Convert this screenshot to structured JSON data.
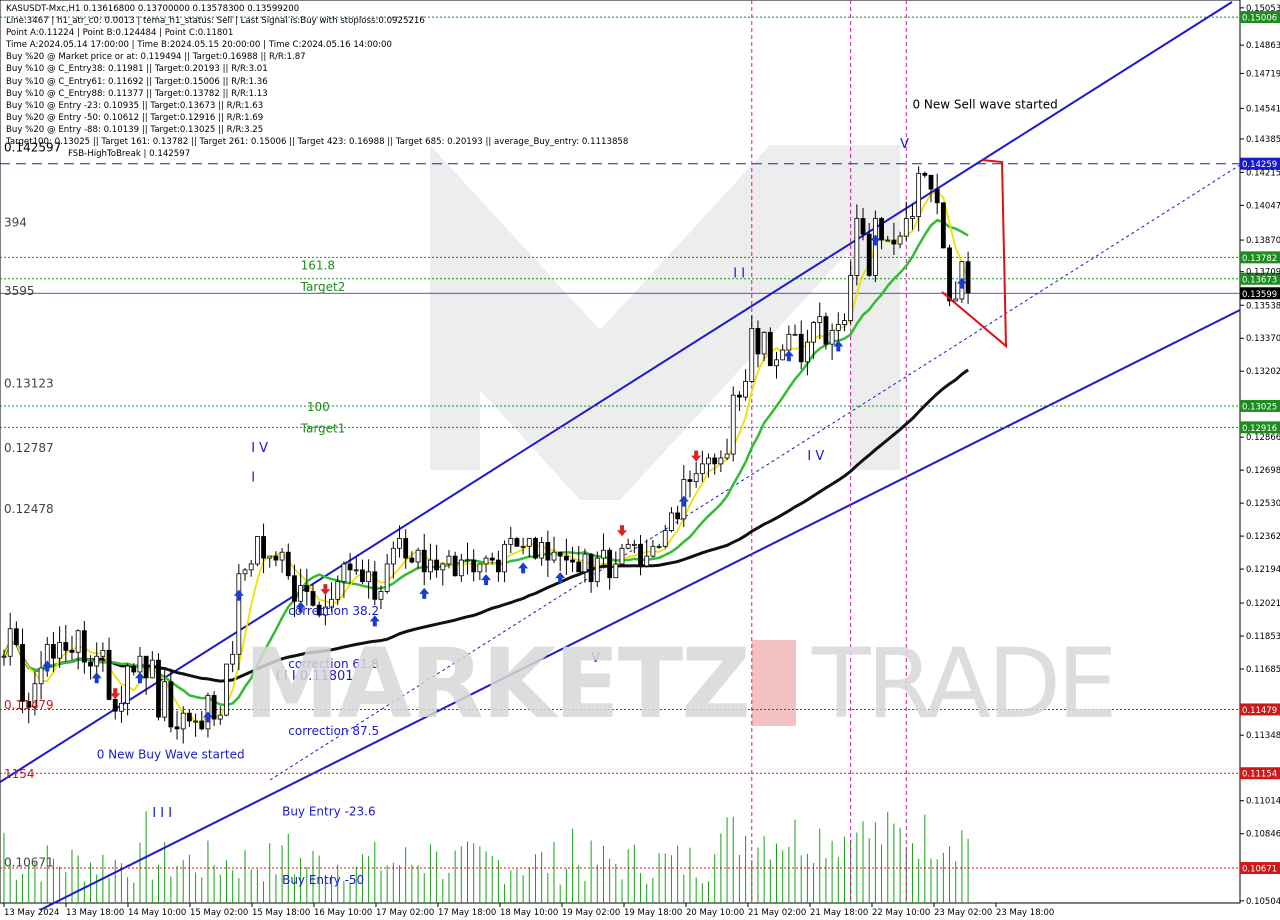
{
  "symbol_header": "KASUSDT-Mxc,H1  0.13616800 0.13700000 0.13578300 0.13599200",
  "info_lines": [
    "Line:3467 | h1_atr_c0: 0.0013 | tema_h1_status: Sell | Last Signal is:Buy with stoploss:0.0925216",
    "Point A:0.11224 | Point B:0.124484 | Point C:0.11801",
    "Time A:2024.05.14 17:00:00 | Time B:2024.05.15 20:00:00 | Time C:2024.05.16 14:00:00",
    "Buy %20 @ Market price or at: 0.119494 || Target:0.16988 || R/R:1.87",
    "Buy %10 @ C_Entry38: 0.11981 || Target:0.20193 || R/R:3.01",
    "Buy %10 @ C_Entry61: 0.11692 || Target:0.15006 || R/R:1.36",
    "Buy %10 @ C_Entry88: 0.11377 || Target:0.13782 || R/R:1.13",
    "Buy %10 @ Entry -23: 0.10935 || Target:0.13673 || R/R:1.63",
    "Buy %20 @ Entry -50: 0.10612 || Target:0.12916 || R/R:1.69",
    "Buy %20 @ Entry -88: 0.10139 || Target:0.13025 || R/R:3.25",
    "Target100: 0.13025 || Target 161: 0.13782 || Target 261: 0.15006 || Target 423: 0.16988 || Target 685: 0.20193 || average_Buy_entry: 0.1113858"
  ],
  "fsb_line": "FSB-HighToBreak | 0.142597",
  "watermark": {
    "left": "MARKETZ",
    "right": "TRADE"
  },
  "chart_data": {
    "type": "candlestick",
    "symbol": "KASUSDT-Mxc",
    "timeframe": "H1",
    "ohlc_last": {
      "open": 0.136168,
      "high": 0.137,
      "low": 0.135783,
      "close": 0.135992
    },
    "ylim": [
      0.10493,
      0.15093
    ],
    "y_ticks": [
      "0.15053",
      "0.14863",
      "0.14719",
      "0.14541",
      "0.14385",
      "0.14215",
      "0.14047",
      "0.13870",
      "0.13709",
      "0.13538",
      "0.13370",
      "0.13202",
      "0.12866",
      "0.12698",
      "0.12530",
      "0.12362",
      "0.12194",
      "0.12021",
      "0.11853",
      "0.11685",
      "0.11348",
      "0.11014",
      "0.10846",
      "0.10504"
    ],
    "x_labels": [
      "13 May 2024",
      "13 May 18:00",
      "14 May 10:00",
      "15 May 02:00",
      "15 May 18:00",
      "16 May 10:00",
      "17 May 02:00",
      "17 May 18:00",
      "18 May 10:00",
      "19 May 02:00",
      "19 May 18:00",
      "20 May 10:00",
      "21 May 02:00",
      "21 May 18:00",
      "22 May 10:00",
      "23 May 02:00",
      "23 May 18:00"
    ],
    "current_price": {
      "value": 0.13599,
      "label": "0.13599"
    },
    "price_levels": [
      {
        "value": 0.15006,
        "label": "0.15006",
        "color": "#1e8c1e",
        "style": "dot"
      },
      {
        "value": 0.14259,
        "label": "0.14259",
        "color": "#1a1acc",
        "style": "dash"
      },
      {
        "value": 0.13782,
        "label": "0.13782",
        "color": "#1e8c1e",
        "style": "dot"
      },
      {
        "value": 0.13673,
        "label": "0.13673",
        "color": "#1e8c1e",
        "style": "dot"
      },
      {
        "value": 0.13025,
        "label": "0.13025",
        "color": "#1e8c1e",
        "style": "dot"
      },
      {
        "value": 0.12916,
        "label": "0.12916",
        "color": "#1e8c1e",
        "style": "dot"
      },
      {
        "value": 0.11479,
        "label": "0.11479",
        "color": "#cc1a1a",
        "style": "dot"
      },
      {
        "value": 0.11154,
        "label": "0.11154",
        "color": "#cc1a1a",
        "style": "dot"
      },
      {
        "value": 0.10671,
        "label": "0.10671",
        "color": "#cc1a1a",
        "style": "dot"
      }
    ],
    "left_labels": [
      {
        "text": "0.142597",
        "value": 0.1432,
        "color": "#000000"
      },
      {
        "text": "394",
        "value": 0.1394,
        "color": "#444444"
      },
      {
        "text": "3595",
        "value": 0.1359,
        "color": "#444444"
      },
      {
        "text": "0.13123",
        "value": 0.1312,
        "color": "#444444"
      },
      {
        "text": "0.12787",
        "value": 0.1279,
        "color": "#444444"
      },
      {
        "text": "0.12478",
        "value": 0.1248,
        "color": "#444444"
      },
      {
        "text": "0.11479",
        "value": 0.1148,
        "color": "#cc1a1a"
      },
      {
        "text": "1154",
        "value": 0.1113,
        "color": "#cc1a1a"
      },
      {
        "text": "0.10671",
        "value": 0.1068,
        "color": "#444444"
      }
    ],
    "annotations": [
      {
        "text": "161.8",
        "bar": 48,
        "value": 0.1372,
        "color": "#1e8c1e"
      },
      {
        "text": "Target2",
        "bar": 48,
        "value": 0.1361,
        "color": "#1e8c1e"
      },
      {
        "text": "100",
        "bar": 49,
        "value": 0.13,
        "color": "#1e8c1e"
      },
      {
        "text": "Target1",
        "bar": 48,
        "value": 0.1289,
        "color": "#1e8c1e"
      },
      {
        "text": "correction 38.2",
        "bar": 46,
        "value": 0.1196,
        "color": "#1a1acc"
      },
      {
        "text": "correction 61.8",
        "bar": 46,
        "value": 0.1169,
        "color": "#1a1acc"
      },
      {
        "text": "correction 87.5",
        "bar": 46,
        "value": 0.1135,
        "color": "#1a1acc"
      },
      {
        "text": "Buy Entry -23.6",
        "bar": 45,
        "value": 0.1094,
        "color": "#1a1acc"
      },
      {
        "text": "Buy Entry -50",
        "bar": 45,
        "value": 0.1059,
        "color": "#1a1acc"
      },
      {
        "text": "0 New Buy Wave started",
        "bar": 15,
        "value": 0.1123,
        "color": "#1a1acc"
      },
      {
        "text": "0 New Sell wave started",
        "bar": 147,
        "value": 0.1454,
        "color": "#000000"
      }
    ],
    "wave_labels": [
      {
        "text": "I V",
        "bar": 40,
        "value": 0.1279
      },
      {
        "text": "I",
        "bar": 40,
        "value": 0.1264
      },
      {
        "text": "I I I",
        "bar": 24,
        "value": 0.1093
      },
      {
        "text": "I I I 0.11801",
        "bar": 44,
        "value": 0.1163
      },
      {
        "text": "V",
        "bar": 95,
        "value": 0.1172
      },
      {
        "text": "I I",
        "bar": 118,
        "value": 0.1368
      },
      {
        "text": "I V",
        "bar": 130,
        "value": 0.1275
      },
      {
        "text": "V",
        "bar": 145,
        "value": 0.1434
      }
    ],
    "fsb_high_to_break": 0.142597,
    "vertical_time_markers": [
      121,
      137,
      146
    ],
    "series": [
      {
        "name": "main",
        "values": [
          0.1175,
          0.1189,
          0.1181,
          0.1152,
          0.1149,
          0.1161,
          0.1169,
          0.1181,
          0.1174,
          0.1182,
          0.1178,
          0.1177,
          0.1188,
          0.1172,
          0.117,
          0.1175,
          0.1178,
          0.1153,
          0.1147,
          0.1151,
          0.117,
          0.1167,
          0.1175,
          0.1164,
          0.1173,
          0.1144,
          0.1162,
          0.1139,
          0.1138,
          0.1146,
          0.1142,
          0.1142,
          0.1138,
          0.1155,
          0.1143,
          0.1145,
          0.1171,
          0.1176,
          0.1217,
          0.1219,
          0.1222,
          0.1236,
          0.1225,
          0.1226,
          0.1224,
          0.1228,
          0.1216,
          0.1203,
          0.1211,
          0.1208,
          0.1201,
          0.1196,
          0.12,
          0.1204,
          0.1213,
          0.1222,
          0.1219,
          0.1219,
          0.1213,
          0.1218,
          0.1204,
          0.1208,
          0.1222,
          0.123,
          0.1235,
          0.1225,
          0.1223,
          0.1229,
          0.1218,
          0.1224,
          0.1219,
          0.1222,
          0.1226,
          0.1216,
          0.1224,
          0.1224,
          0.1218,
          0.1222,
          0.1225,
          0.1224,
          0.1218,
          0.1232,
          0.1235,
          0.1231,
          0.1231,
          0.1235,
          0.1225,
          0.1233,
          0.1224,
          0.1228,
          0.1226,
          0.1224,
          0.1223,
          0.1218,
          0.1227,
          0.1213,
          0.1225,
          0.1229,
          0.1215,
          0.1222,
          0.123,
          0.1232,
          0.1232,
          0.1221,
          0.1226,
          0.1231,
          0.1231,
          0.1239,
          0.1248,
          0.1245,
          0.1265,
          0.1264,
          0.1268,
          0.1273,
          0.1276,
          0.1273,
          0.1276,
          0.1278,
          0.1308,
          0.1307,
          0.1315,
          0.1342,
          0.1329,
          0.134,
          0.1323,
          0.1326,
          0.1331,
          0.1339,
          0.1339,
          0.1325,
          0.1335,
          0.1345,
          0.1348,
          0.1334,
          0.1341,
          0.1344,
          0.1346,
          0.1369,
          0.1398,
          0.139,
          0.1369,
          0.1398,
          0.1387,
          0.1387,
          0.1385,
          0.1389,
          0.1398,
          0.1399,
          0.1421,
          0.142,
          0.1413,
          0.1406,
          0.1383,
          0.1356,
          0.1357,
          0.1376,
          0.136
        ]
      }
    ]
  }
}
